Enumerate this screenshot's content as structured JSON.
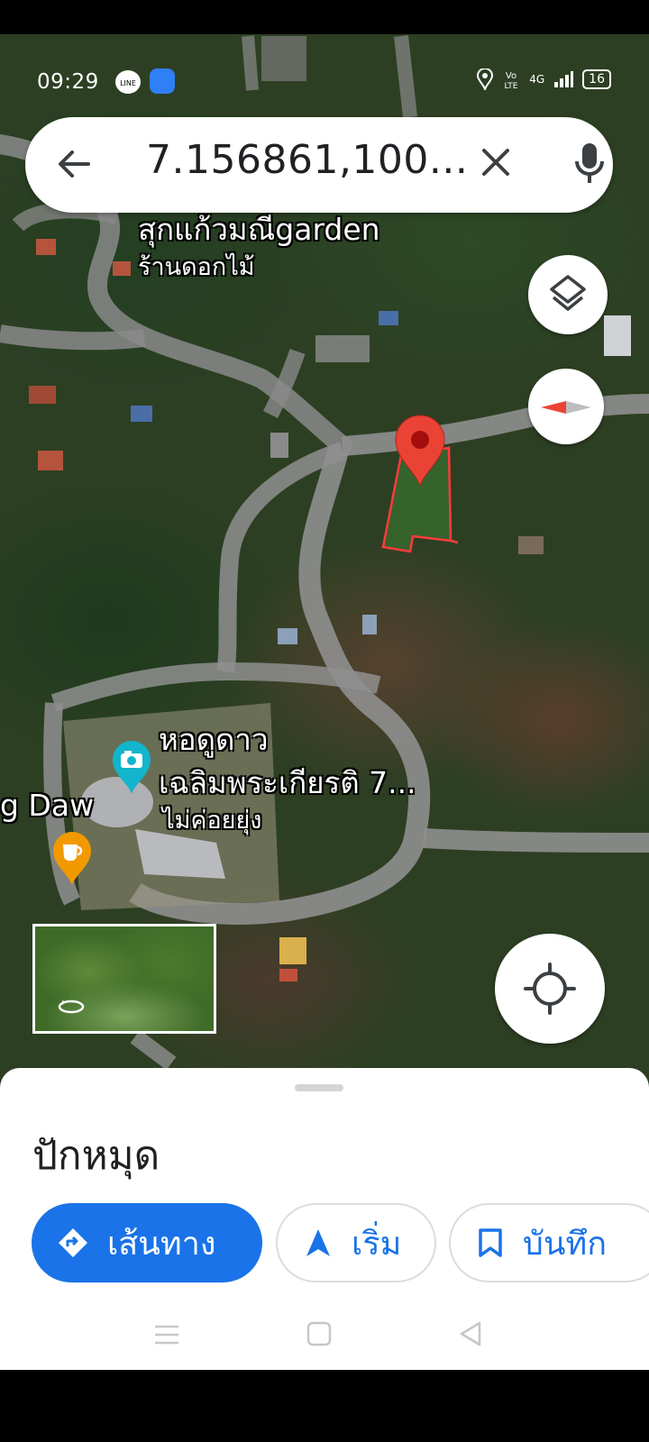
{
  "status_bar": {
    "time": "09:29",
    "line_icon": "line-icon",
    "app_icon": "app-icon",
    "battery": "16",
    "network": "4G"
  },
  "search": {
    "query": "7.156861,100...",
    "back_icon": "arrow-back-icon",
    "clear_icon": "close-icon",
    "mic_icon": "mic-icon"
  },
  "map": {
    "labels": {
      "shop_name": "สุกแก้วมณีgarden",
      "shop_type": "ร้านดอกไม้",
      "observatory_name_1": "หอดูดาว",
      "observatory_name_2": "เฉลิมพระเกียรติ 7...",
      "observatory_status": "ไม่ค่อยยุ่ง",
      "partial_label": "g Daw"
    },
    "pin_color": "#ea4335",
    "parcel_outline_color": "#ff3b3b"
  },
  "bottom_sheet": {
    "title": "ปักหมุด",
    "directions_label": "เส้นทาง",
    "start_label": "เริ่ม",
    "save_label": "บันทึก",
    "accent": "#1a73e8"
  }
}
